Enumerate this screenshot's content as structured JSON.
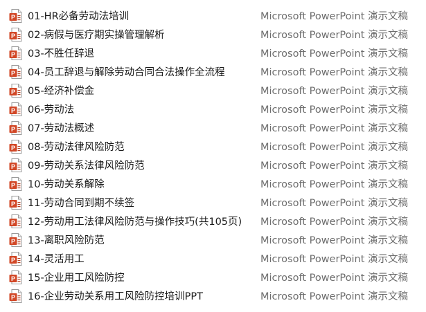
{
  "colors": {
    "ppt_orange": "#d24726",
    "ppt_orange_dark": "#b7472a",
    "type_text": "#6d6d6d"
  },
  "icon": "powerpoint-file-icon",
  "files": [
    {
      "name": "01-HR必备劳动法培训",
      "type": "Microsoft PowerPoint 演示文稿"
    },
    {
      "name": "02-病假与医疗期实操管理解析",
      "type": "Microsoft PowerPoint 演示文稿"
    },
    {
      "name": "03-不胜任辞退",
      "type": "Microsoft PowerPoint 演示文稿"
    },
    {
      "name": "04-员工辞退与解除劳动合同合法操作全流程",
      "type": "Microsoft PowerPoint 演示文稿"
    },
    {
      "name": "05-经济补偿金",
      "type": "Microsoft PowerPoint 演示文稿"
    },
    {
      "name": "06-劳动法",
      "type": "Microsoft PowerPoint 演示文稿"
    },
    {
      "name": "07-劳动法概述",
      "type": "Microsoft PowerPoint 演示文稿"
    },
    {
      "name": "08-劳动法律风险防范",
      "type": "Microsoft PowerPoint 演示文稿"
    },
    {
      "name": "09-劳动关系法律风险防范",
      "type": "Microsoft PowerPoint 演示文稿"
    },
    {
      "name": "10-劳动关系解除",
      "type": "Microsoft PowerPoint 演示文稿"
    },
    {
      "name": "11-劳动合同到期不续签",
      "type": "Microsoft PowerPoint 演示文稿"
    },
    {
      "name": "12-劳动用工法律风险防范与操作技巧(共105页)",
      "type": "Microsoft PowerPoint 演示文稿"
    },
    {
      "name": "13-离职风险防范",
      "type": "Microsoft PowerPoint 演示文稿"
    },
    {
      "name": "14-灵活用工",
      "type": "Microsoft PowerPoint 演示文稿"
    },
    {
      "name": "15-企业用工风险防控",
      "type": "Microsoft PowerPoint 演示文稿"
    },
    {
      "name": "16-企业劳动关系用工风险防控培训PPT",
      "type": "Microsoft PowerPoint 演示文稿"
    }
  ]
}
